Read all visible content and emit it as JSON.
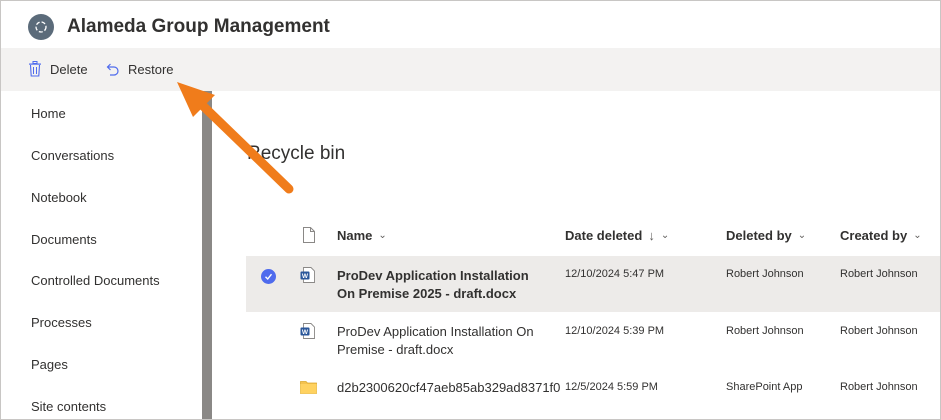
{
  "header": {
    "title": "Alameda Group Management"
  },
  "toolbar": {
    "delete_label": "Delete",
    "restore_label": "Restore"
  },
  "sidebar": {
    "items": [
      {
        "label": "Home"
      },
      {
        "label": "Conversations"
      },
      {
        "label": "Notebook"
      },
      {
        "label": "Documents"
      },
      {
        "label": "Controlled Documents"
      },
      {
        "label": "Processes"
      },
      {
        "label": "Pages"
      },
      {
        "label": "Site contents"
      }
    ]
  },
  "main": {
    "title": "Recycle bin",
    "columns": {
      "name": "Name",
      "date_deleted": "Date deleted",
      "deleted_by": "Deleted by",
      "created_by": "Created by"
    },
    "rows": [
      {
        "name": "ProDev Application Installation On Premise 2025 - draft.docx",
        "date_deleted": "12/10/2024 5:47 PM",
        "deleted_by": "Robert Johnson",
        "created_by": "Robert Johnson",
        "selected": true,
        "icon": "word-doc-icon"
      },
      {
        "name": "ProDev Application Installation On Premise - draft.docx",
        "date_deleted": "12/10/2024 5:39 PM",
        "deleted_by": "Robert Johnson",
        "created_by": "Robert Johnson",
        "selected": false,
        "icon": "word-doc-icon"
      },
      {
        "name": "d2b2300620cf47aeb85ab329ad8371f0",
        "date_deleted": "12/5/2024 5:59 PM",
        "deleted_by": "SharePoint App",
        "created_by": "Robert Johnson",
        "selected": false,
        "icon": "folder-icon"
      }
    ]
  },
  "colors": {
    "accent": "#4f6bed",
    "annotation_arrow": "#f07c1b",
    "toolbar_bg": "#f3f2f1",
    "selected_row_bg": "#edebe9"
  }
}
